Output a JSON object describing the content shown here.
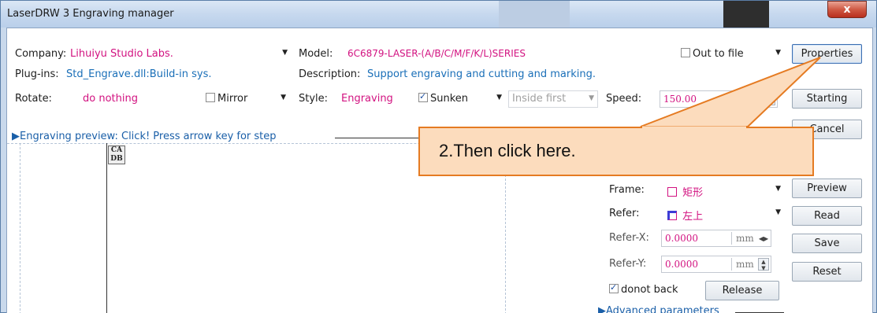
{
  "window": {
    "title": "LaserDRW 3 Engraving manager",
    "close_label": "x"
  },
  "company": {
    "label": "Company:",
    "value": "Lihuiyu Studio Labs."
  },
  "model": {
    "label": "Model:",
    "value": "6C6879-LASER-(A/B/C/M/F/K/L)SERIES"
  },
  "out_to_file": {
    "label": "Out to file",
    "checked": false
  },
  "plugins": {
    "label": "Plug-ins:",
    "value": "Std_Engrave.dll:Build-in sys."
  },
  "description": {
    "label": "Description:",
    "value": "Support engraving and cutting and marking."
  },
  "rotate": {
    "label": "Rotate:",
    "value": "do nothing"
  },
  "mirror": {
    "label": "Mirror",
    "checked": false
  },
  "style": {
    "label": "Style:",
    "value": "Engraving"
  },
  "sunken": {
    "label": "Sunken",
    "checked": true
  },
  "inside_first": {
    "value": "Inside first"
  },
  "speed": {
    "label": "Speed:",
    "value": "150.00"
  },
  "buttons": {
    "properties": "Properties",
    "starting": "Starting",
    "cancel": "Cancel",
    "preview": "Preview",
    "read": "Read",
    "save": "Save",
    "reset": "Reset",
    "release": "Release"
  },
  "preview_header": "Engraving preview: Click! Press arrow key for step",
  "cadb_icon": {
    "line1": "CA",
    "line2": "DB"
  },
  "frame": {
    "label": "Frame:",
    "value": "矩形"
  },
  "refer": {
    "label": "Refer:",
    "value": "左上"
  },
  "refer_x": {
    "label": "Refer-X:",
    "value": "0.0000",
    "unit": "mm"
  },
  "refer_y": {
    "label": "Refer-Y:",
    "value": "0.0000",
    "unit": "mm"
  },
  "donot_back": {
    "label": "donot back",
    "checked": true
  },
  "advanced_header": "Advanced parameters",
  "callout": {
    "text": "2.Then click here."
  },
  "colors": {
    "accent_pink": "#d21280",
    "link_blue": "#1a6fb8",
    "callout_fill": "#fcdcbd",
    "callout_border": "#e57b22"
  }
}
